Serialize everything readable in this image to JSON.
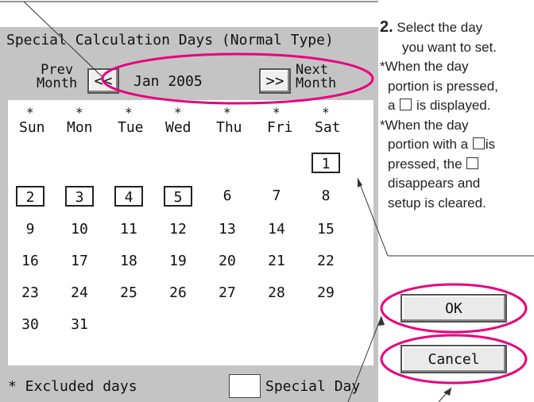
{
  "screen": {
    "title": "Special Calculation Days (Normal Type)",
    "prev_label_1": "Prev",
    "prev_label_2": "Month",
    "next_label_1": "Next",
    "next_label_2": "Month",
    "prev_button": "<<",
    "next_button": ">>",
    "month": "Jan 2005",
    "excluded_mark": "*",
    "weekdays": [
      "Sun",
      "Mon",
      "Tue",
      "Wed",
      "Thu",
      "Fri",
      "Sat"
    ],
    "days": [
      "1",
      "2",
      "3",
      "4",
      "5",
      "6",
      "7",
      "8",
      "9",
      "10",
      "11",
      "12",
      "13",
      "14",
      "15",
      "16",
      "17",
      "18",
      "19",
      "20",
      "21",
      "22",
      "23",
      "24",
      "25",
      "26",
      "27",
      "28",
      "29",
      "30",
      "31"
    ],
    "selected_days": [
      "1",
      "2",
      "3",
      "4",
      "5"
    ],
    "legend_excluded": "* Excluded days",
    "legend_special": "Special Day",
    "ok_label": "OK",
    "cancel_label": "Cancel"
  },
  "note": {
    "step": "2.",
    "line1": "Select the day",
    "line2": "you want to set.",
    "line3": "*When the day",
    "line4": "portion is pressed,",
    "line5a": "a",
    "line5b": "is displayed.",
    "line6": "*When the day",
    "line7a": "portion with a",
    "line7b": "is",
    "line8a": "pressed, the",
    "line9": "disappears and",
    "line10": "setup is cleared."
  },
  "annotation_color": "#e8007d"
}
